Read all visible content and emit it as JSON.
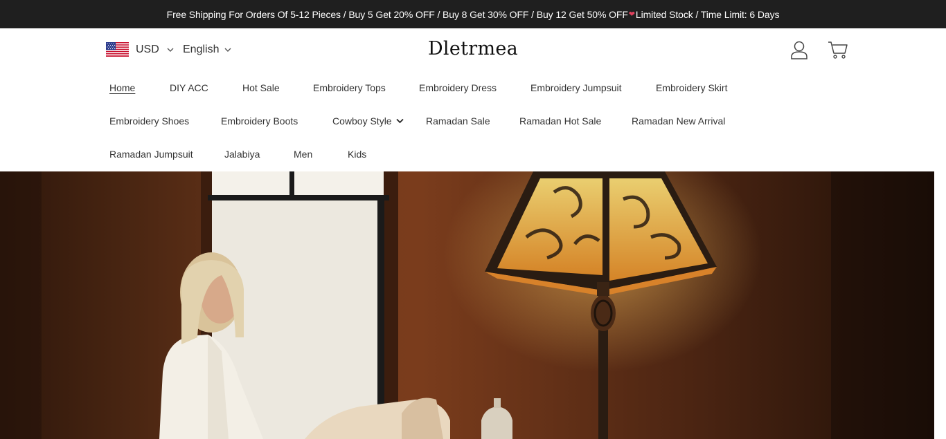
{
  "announcement": {
    "text_before": "Free Shipping For Orders Of 5-12 Pieces / Buy 5 Get 20% OFF / Buy 8 Get 30% OFF / Buy 12 Get 50% OFF",
    "heart_icon": "❤",
    "text_after": "Limited Stock / Time Limit: 6 Days"
  },
  "header": {
    "currency": "USD",
    "language": "English",
    "logo": "Dletrmea"
  },
  "nav": {
    "items": [
      {
        "label": "Home"
      },
      {
        "label": "DIY ACC"
      },
      {
        "label": "Hot Sale"
      },
      {
        "label": "Embroidery Tops"
      },
      {
        "label": "Embroidery Dress"
      },
      {
        "label": "Embroidery Jumpsuit"
      },
      {
        "label": "Embroidery Skirt"
      },
      {
        "label": "Embroidery Shoes"
      },
      {
        "label": "Embroidery Boots"
      },
      {
        "label": "Cowboy Style"
      },
      {
        "label": "Ramadan Sale"
      },
      {
        "label": "Ramadan Hot Sale"
      },
      {
        "label": "Ramadan New Arrival"
      },
      {
        "label": "Ramadan Jumpsuit"
      },
      {
        "label": "Jalabiya"
      },
      {
        "label": "Men"
      },
      {
        "label": "Kids"
      }
    ]
  },
  "colors": {
    "announcement_bg": "#1f1f1f",
    "hero_wall": "#4a2614",
    "lamp_glow": "#f0a030"
  }
}
